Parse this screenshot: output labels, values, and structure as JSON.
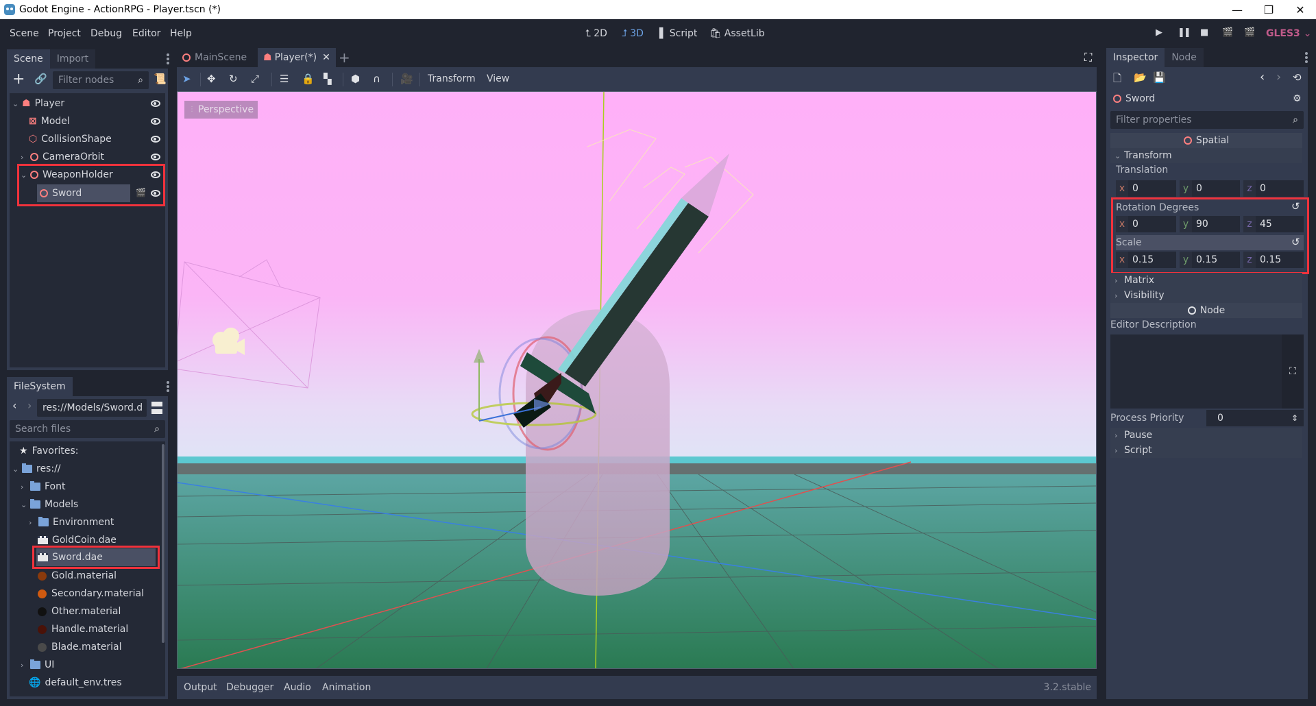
{
  "window": {
    "title": "Godot Engine - ActionRPG - Player.tscn (*)",
    "controls": {
      "minimize": "—",
      "maximize": "❐",
      "close": "✕"
    }
  },
  "menu": {
    "items": [
      "Scene",
      "Project",
      "Debug",
      "Editor",
      "Help"
    ],
    "modes": [
      {
        "label": "2D",
        "icon": "2d-icon",
        "active": false
      },
      {
        "label": "3D",
        "icon": "3d-icon",
        "active": true
      },
      {
        "label": "Script",
        "icon": "script-icon",
        "active": false
      },
      {
        "label": "AssetLib",
        "icon": "assetlib-icon",
        "active": false
      }
    ],
    "run_icons": [
      "▶",
      "❚❚",
      "■",
      "▶",
      "▣"
    ],
    "renderer": "GLES3",
    "accent_color": "#e0619a"
  },
  "scene_dock": {
    "tabs": [
      "Scene",
      "Import"
    ],
    "filter_placeholder": "Filter nodes",
    "tree": [
      {
        "name": "Player",
        "icon": "kinematic-body-icon",
        "level": 0,
        "expanded": true
      },
      {
        "name": "Model",
        "icon": "mesh-instance-icon",
        "level": 1
      },
      {
        "name": "CollisionShape",
        "icon": "collision-shape-icon",
        "level": 1
      },
      {
        "name": "CameraOrbit",
        "icon": "spatial-icon",
        "level": 1,
        "collapsed": true
      },
      {
        "name": "WeaponHolder",
        "icon": "spatial-icon",
        "level": 1,
        "expanded": true,
        "highlighted": true
      },
      {
        "name": "Sword",
        "icon": "spatial-icon",
        "level": 2,
        "selected": true,
        "highlighted": true,
        "instanced": true
      }
    ]
  },
  "filesystem": {
    "tab": "FileSystem",
    "path": "res://Models/Sword.d",
    "search_placeholder": "Search files",
    "favorites_label": "Favorites:",
    "items": [
      {
        "name": "res://",
        "type": "folder",
        "level": 0,
        "expanded": true
      },
      {
        "name": "Font",
        "type": "folder",
        "level": 1,
        "collapsed": true
      },
      {
        "name": "Models",
        "type": "folder",
        "level": 1,
        "expanded": true
      },
      {
        "name": "Environment",
        "type": "folder",
        "level": 2,
        "collapsed": true
      },
      {
        "name": "GoldCoin.dae",
        "type": "scene",
        "level": 2
      },
      {
        "name": "Sword.dae",
        "type": "scene",
        "level": 2,
        "selected": true,
        "highlighted": true
      },
      {
        "name": "Gold.material",
        "type": "material",
        "level": 2,
        "color": "#8a3a0c"
      },
      {
        "name": "Secondary.material",
        "type": "material",
        "level": 2,
        "color": "#d05a10"
      },
      {
        "name": "Other.material",
        "type": "material",
        "level": 2,
        "color": "#111111"
      },
      {
        "name": "Handle.material",
        "type": "material",
        "level": 2,
        "color": "#4a1208"
      },
      {
        "name": "Blade.material",
        "type": "material",
        "level": 2,
        "color": "#4a4a4a"
      },
      {
        "name": "UI",
        "type": "folder",
        "level": 1,
        "collapsed": true
      },
      {
        "name": "default_env.tres",
        "type": "environment",
        "level": 1
      }
    ]
  },
  "editor_tabs": [
    {
      "label": "MainScene",
      "active": false
    },
    {
      "label": "Player(*)",
      "active": true
    }
  ],
  "viewport_toolbar": {
    "menus": [
      "Transform",
      "View"
    ],
    "perspective_label": "Perspective"
  },
  "bottom_panel": {
    "tabs": [
      "Output",
      "Debugger",
      "Audio",
      "Animation"
    ],
    "version": "3.2.stable"
  },
  "inspector": {
    "tabs": [
      "Inspector",
      "Node"
    ],
    "node_name": "Sword",
    "filter_placeholder": "Filter properties",
    "class_header": "Spatial",
    "transform_label": "Transform",
    "translation": {
      "label": "Translation",
      "x": "0",
      "y": "0",
      "z": "0"
    },
    "rotation": {
      "label": "Rotation Degrees",
      "x": "0",
      "y": "90",
      "z": "45"
    },
    "scale": {
      "label": "Scale",
      "x": "0.15",
      "y": "0.15",
      "z": "0.15"
    },
    "matrix_label": "Matrix",
    "visibility_label": "Visibility",
    "node_header": "Node",
    "editor_description_label": "Editor Description",
    "process_priority": {
      "label": "Process Priority",
      "value": "0"
    },
    "pause_label": "Pause",
    "script_label": "Script",
    "axis_colors": {
      "x": "#c47865",
      "y": "#6f9c6a",
      "z": "#7566a8"
    }
  }
}
